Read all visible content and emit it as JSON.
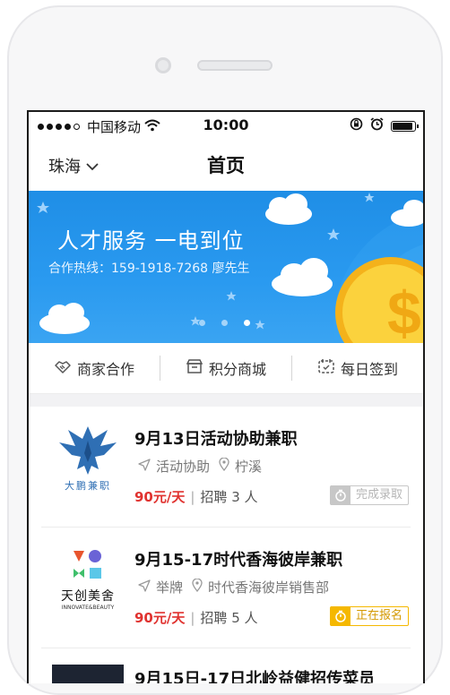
{
  "status_bar": {
    "carrier": "中国移动",
    "time": "10:00"
  },
  "nav": {
    "city": "珠海",
    "title": "首页"
  },
  "banner": {
    "title": "人才服务  一电到位",
    "subtitle": "合作热线：159-1918-7268 廖先生",
    "page_count": 3,
    "active_page": 3
  },
  "quick_actions": [
    {
      "label": "商家合作",
      "icon": "handshake-icon"
    },
    {
      "label": "积分商城",
      "icon": "shop-icon"
    },
    {
      "label": "每日签到",
      "icon": "calendar-icon"
    }
  ],
  "jobs": [
    {
      "title": "9月13日活动协助兼职",
      "category": "活动协助",
      "location": "柠溪",
      "pay": "90元/天",
      "hire": "招聘 3 人",
      "status": "完成录取",
      "status_type": "done",
      "logo_text": "大鹏兼职"
    },
    {
      "title": "9月15-17时代香海彼岸兼职",
      "category": "举牌",
      "location": "时代香海彼岸销售部",
      "pay": "90元/天",
      "hire": "招聘 5 人",
      "status": "正在报名",
      "status_type": "open",
      "logo_text": "天创美舍",
      "logo_subtext": "INNOVATE&BEAUTY"
    },
    {
      "title": "9月15日-17日北岭益健招传菜员"
    }
  ],
  "colors": {
    "banner_blue": "#2a9af0",
    "pay_red": "#e0322f",
    "open_badge": "#f5b800",
    "done_badge": "#c7c7c7",
    "eagle_blue": "#2f6fb4"
  }
}
